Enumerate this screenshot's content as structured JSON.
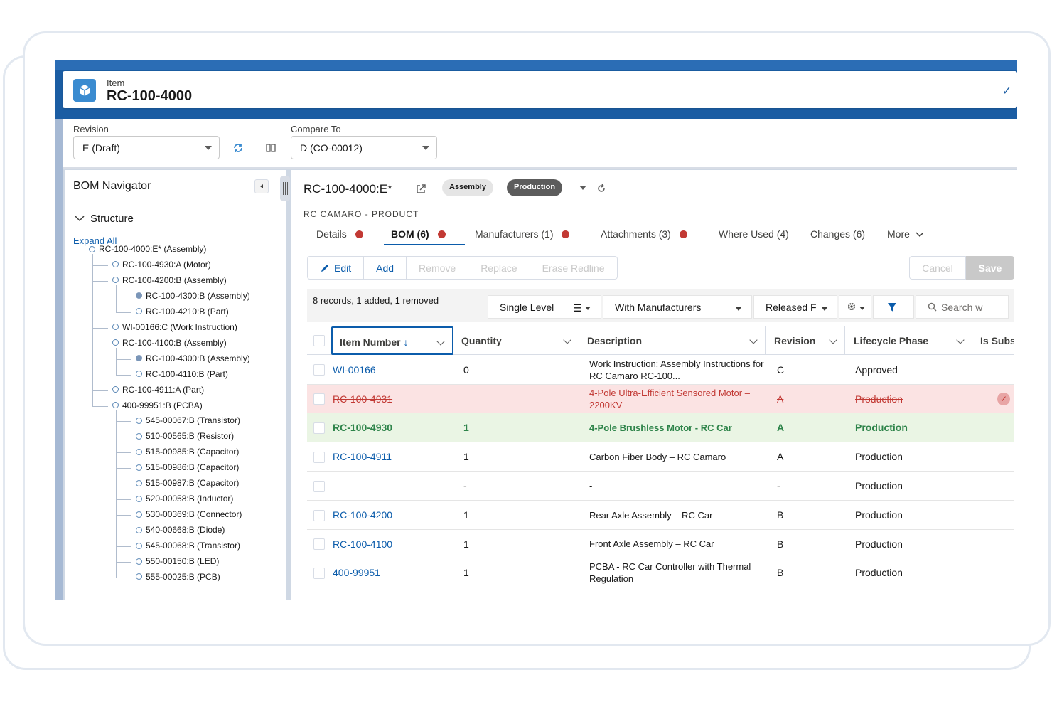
{
  "header": {
    "object_label": "Item",
    "record_name": "RC-100-4000"
  },
  "revision_bar": {
    "revision_label": "Revision",
    "revision_value": "E (Draft)",
    "compare_label": "Compare To",
    "compare_value": "D (CO-00012)"
  },
  "navigator": {
    "title": "BOM Navigator",
    "structure_label": "Structure",
    "expand_all": "Expand All",
    "nodes": [
      {
        "label": "RC-100-4000:E* (Assembly)",
        "filled": false
      },
      {
        "label": "RC-100-4930:A (Motor)",
        "filled": false
      },
      {
        "label": "RC-100-4200:B (Assembly)",
        "filled": false
      },
      {
        "label": "RC-100-4300:B (Assembly)",
        "filled": true
      },
      {
        "label": "RC-100-4210:B (Part)",
        "filled": false
      },
      {
        "label": "WI-00166:C (Work Instruction)",
        "filled": false
      },
      {
        "label": "RC-100-4100:B (Assembly)",
        "filled": false
      },
      {
        "label": "RC-100-4300:B (Assembly)",
        "filled": true
      },
      {
        "label": "RC-100-4110:B (Part)",
        "filled": false
      },
      {
        "label": "RC-100-4911:A (Part)",
        "filled": false
      },
      {
        "label": "400-99951:B (PCBA)",
        "filled": false
      },
      {
        "label": "545-00067:B (Transistor)",
        "filled": false
      },
      {
        "label": "510-00565:B (Resistor)",
        "filled": false
      },
      {
        "label": "515-00985:B (Capacitor)",
        "filled": false
      },
      {
        "label": "515-00986:B (Capacitor)",
        "filled": false
      },
      {
        "label": "515-00987:B (Capacitor)",
        "filled": false
      },
      {
        "label": "520-00058:B (Inductor)",
        "filled": false
      },
      {
        "label": "530-00369:B (Connector)",
        "filled": false
      },
      {
        "label": "540-00668:B (Diode)",
        "filled": false
      },
      {
        "label": "545-00068:B (Transistor)",
        "filled": false
      },
      {
        "label": "550-00150:B (LED)",
        "filled": false
      },
      {
        "label": "555-00025:B (PCB)",
        "filled": false
      }
    ]
  },
  "record": {
    "title": "RC-100-4000:E*",
    "type_pill": "Assembly",
    "status_pill": "Production",
    "subtitle": "RC CAMARO - PRODUCT"
  },
  "tabs": [
    {
      "label": "Details",
      "dot": true
    },
    {
      "label": "BOM (6)",
      "dot": true
    },
    {
      "label": "Manufacturers (1)",
      "dot": true
    },
    {
      "label": "Attachments (3)",
      "dot": true
    },
    {
      "label": "Where Used (4)",
      "dot": false
    },
    {
      "label": "Changes (6)",
      "dot": false
    },
    {
      "label": "More",
      "dot": false
    }
  ],
  "toolbar": {
    "edit": "Edit",
    "add": "Add",
    "remove": "Remove",
    "replace": "Replace",
    "erase_redline": "Erase Redline",
    "cancel": "Cancel",
    "save": "Save"
  },
  "filterbar": {
    "records_summary": "8 records, 1 added, 1 removed",
    "level": "Single Level",
    "manufacturers": "With Manufacturers",
    "released": "Released F",
    "search_placeholder": "Search w"
  },
  "grid": {
    "columns": [
      "Item Number",
      "Quantity",
      "Description",
      "Revision",
      "Lifecycle Phase",
      "Is Subs"
    ],
    "rows": [
      {
        "state": "normal",
        "item": "WI-00166",
        "qty": "0",
        "desc": "Work Instruction: Assembly Instructions for RC Camaro RC-100...",
        "rev": "C",
        "phase": "Approved"
      },
      {
        "state": "removed",
        "item": "RC-100-4931",
        "qty": "",
        "desc": "4-Pole Ultra-Efficient Sensored Motor – 2200KV",
        "rev": "A",
        "phase": "Production"
      },
      {
        "state": "added",
        "item": "RC-100-4930",
        "qty": "1",
        "desc": "4-Pole Brushless Motor - RC Car",
        "rev": "A",
        "phase": "Production"
      },
      {
        "state": "normal",
        "item": "RC-100-4911",
        "qty": "1",
        "desc": "Carbon Fiber Body – RC Camaro",
        "rev": "A",
        "phase": "Production"
      },
      {
        "state": "normal",
        "item": "",
        "qty": "-",
        "desc": "-",
        "rev": "-",
        "phase": "Production"
      },
      {
        "state": "normal",
        "item": "RC-100-4200",
        "qty": "1",
        "desc": "Rear Axle Assembly – RC Car",
        "rev": "B",
        "phase": "Production"
      },
      {
        "state": "normal",
        "item": "RC-100-4100",
        "qty": "1",
        "desc": "Front Axle Assembly – RC Car",
        "rev": "B",
        "phase": "Production"
      },
      {
        "state": "normal",
        "item": "400-99951",
        "qty": "1",
        "desc": "PCBA - RC Car Controller with Thermal Regulation",
        "rev": "B",
        "phase": "Production"
      }
    ]
  },
  "colors": {
    "brand": "#1b5da3",
    "link": "#0b5cab",
    "removed_bg": "#fbe3e3",
    "added_bg": "#eaf5e4",
    "dot": "#c23934"
  }
}
